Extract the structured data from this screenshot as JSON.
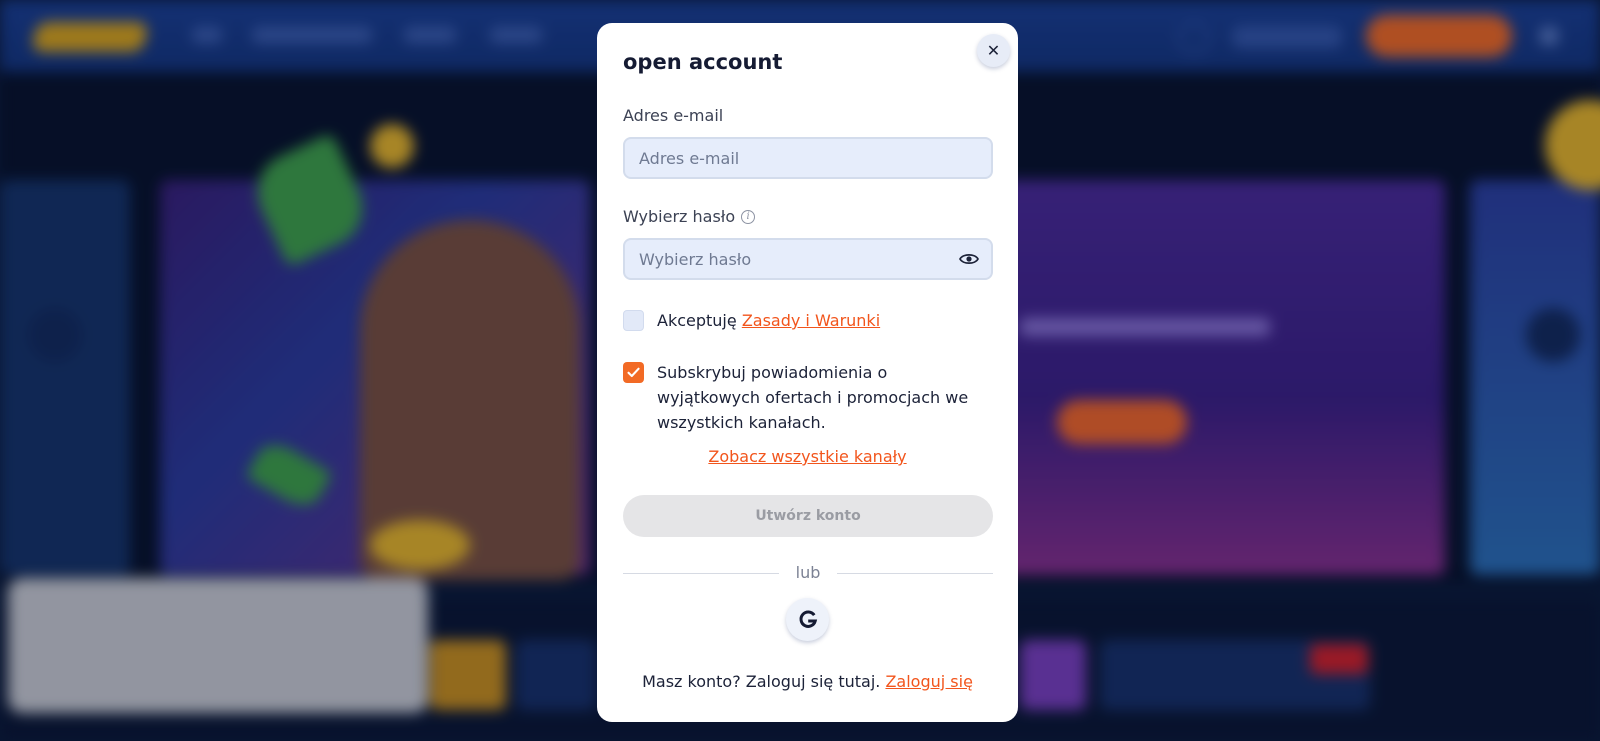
{
  "modal": {
    "title": "open account",
    "close_icon": "close-icon",
    "email": {
      "label": "Adres e-mail",
      "placeholder": "Adres e-mail",
      "value": ""
    },
    "password": {
      "label": "Wybierz hasło",
      "placeholder": "Wybierz hasło",
      "value": "",
      "info_icon": "info-icon",
      "toggle_icon": "eye-icon"
    },
    "terms": {
      "checked": false,
      "text": "Akceptuję",
      "link": "Zasady i Warunki"
    },
    "subscribe": {
      "checked": true,
      "text": "Subskrybuj powiadomienia o wyjątkowych ofertach i promocjach we wszystkich kanałach."
    },
    "channels_link": "Zobacz wszystkie kanały",
    "create_button": "Utwórz konto",
    "divider_text": "lub",
    "google_icon": "google-icon",
    "login_prompt": "Masz konto? Zaloguj się tutaj.",
    "login_link": "Zaloguj się"
  },
  "colors": {
    "accent": "#f26a25",
    "link": "#f2551c",
    "input_bg": "#e6edfb",
    "disabled_button": "#e5e5e7",
    "header_bg": "#1a3f95"
  }
}
